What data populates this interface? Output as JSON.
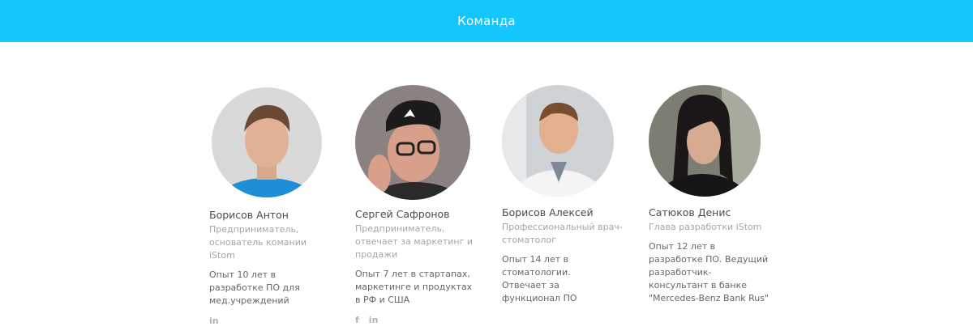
{
  "header": {
    "title": "Команда"
  },
  "members": [
    {
      "name": "Борисов Антон",
      "role": "Предприниматель, основатель комании iStom",
      "bio": "Опыт 10 лет в разработке ПО для мед.учреждений",
      "social": [
        "in"
      ]
    },
    {
      "name": "Сергей Сафронов",
      "role": "Предприниматель, отвечает за маркетинг и продажи",
      "bio": "Опыт 7 лет в стартапах, маркетинге и продуктах в РФ и США",
      "social": [
        "f",
        "in"
      ]
    },
    {
      "name": "Борисов Алексей",
      "role": "Профессиональный врач-стоматолог",
      "bio": "Опыт 14 лет в стоматологии. Отвечает за функционал ПО",
      "social": []
    },
    {
      "name": "Сатюков Денис",
      "role": "Глава разработки iStom",
      "bio": "Опыт 12 лет в разработке ПО. Ведущий разработчик-консультант в банке \"Mercedes-Benz Bank Rus\"",
      "social": []
    }
  ],
  "icons": {
    "facebook": "facebook-icon",
    "linkedin": "linkedin-icon"
  }
}
